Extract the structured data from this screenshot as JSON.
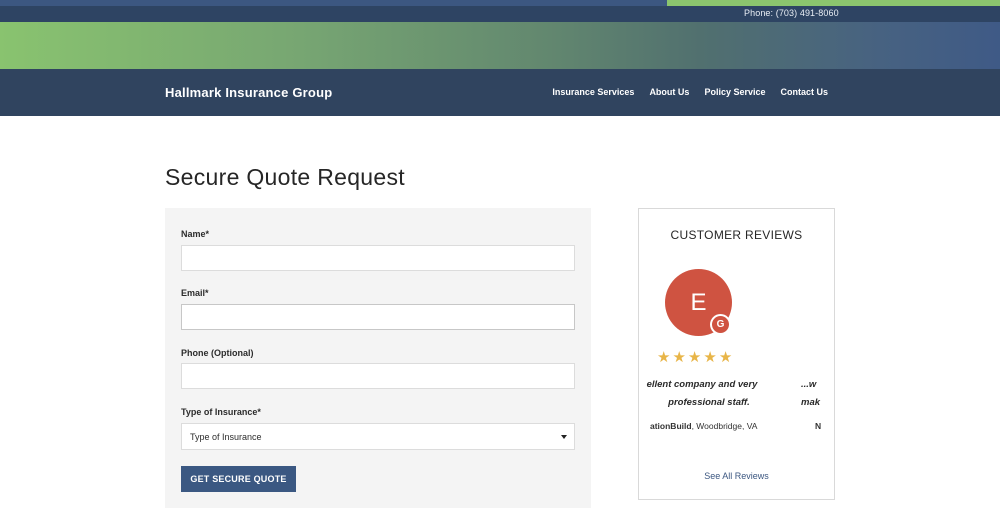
{
  "topbar": {
    "phone": "Phone: (703) 491-8060"
  },
  "colors": {
    "navy": "#30445f",
    "accent_blue": "#3b5882",
    "accent_green": "#8bc56e",
    "avatar_red": "#cf5341",
    "star_gold": "#e8b548"
  },
  "header": {
    "brand": "Hallmark Insurance Group",
    "nav": [
      {
        "label": "Insurance Services"
      },
      {
        "label": "About Us"
      },
      {
        "label": "Policy Service"
      },
      {
        "label": "Contact Us"
      }
    ]
  },
  "main": {
    "title": "Secure Quote Request",
    "form": {
      "fields": [
        {
          "label": "Name*",
          "value": "",
          "placeholder": ""
        },
        {
          "label": "Email*",
          "value": "",
          "placeholder": ""
        },
        {
          "label": "Phone (Optional)",
          "value": "",
          "placeholder": ""
        }
      ],
      "insurance_type": {
        "label": "Type of Insurance*",
        "selected": "Type of Insurance"
      },
      "submit_label": "GET SECURE QUOTE"
    }
  },
  "reviews": {
    "title": "CUSTOMER REVIEWS",
    "avatar_initial": "E",
    "source_badge": "G",
    "rating": 5,
    "rating_max": 5,
    "items": [
      {
        "quote_line1": "ellent company and very",
        "quote_line2": "professional staff.",
        "reviewer_name": "ationBuild",
        "reviewer_location": ", Woodbridge, VA"
      },
      {
        "quote_line1": "...w",
        "quote_line2": "mak",
        "reviewer_name": "N",
        "reviewer_location": ""
      }
    ],
    "see_all_label": "See All Reviews"
  }
}
